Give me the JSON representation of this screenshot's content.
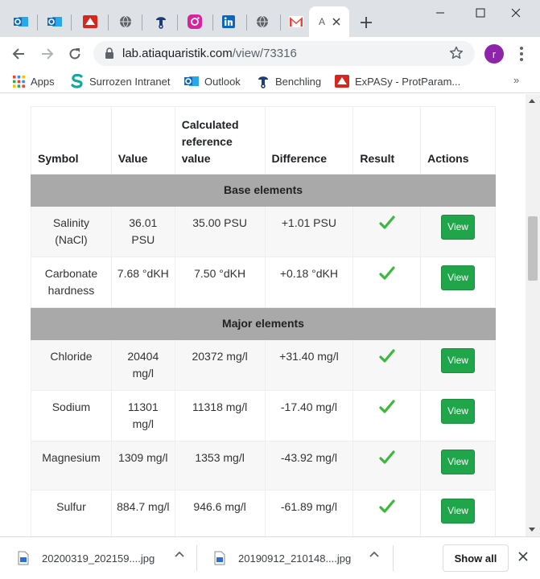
{
  "window": {
    "tabs": [
      {
        "icon": "outlook-icon",
        "color": "#0f6cbd"
      },
      {
        "icon": "outlook-icon",
        "color": "#0f6cbd"
      },
      {
        "icon": "expasy-icon",
        "color": "#d7261e"
      },
      {
        "icon": "globe-icon",
        "color": "#5f6368"
      },
      {
        "icon": "benchling-icon",
        "color": "#1f3b73"
      },
      {
        "icon": "instagram-icon",
        "color": "#d6249f"
      },
      {
        "icon": "linkedin-icon",
        "color": "#0a66c2"
      },
      {
        "icon": "globe-icon",
        "color": "#5f6368"
      },
      {
        "icon": "gmail-icon",
        "color": "#ea4335"
      }
    ],
    "active_tab_title": "A"
  },
  "toolbar": {
    "url_host": "lab.atiaquaristik.com",
    "url_path": "/view/73316",
    "profile_initial": "r"
  },
  "bookmarks": [
    {
      "label": "Apps",
      "icon": "apps-grid-icon"
    },
    {
      "label": "Surrozen Intranet",
      "icon": "surrozen-icon"
    },
    {
      "label": "Outlook",
      "icon": "outlook-icon"
    },
    {
      "label": "Benchling",
      "icon": "benchling-icon"
    },
    {
      "label": "ExPASy - ProtParam...",
      "icon": "expasy-icon"
    }
  ],
  "table": {
    "headers": {
      "symbol": "Symbol",
      "value": "Value",
      "reference": "Calculated reference value",
      "difference": "Difference",
      "result": "Result",
      "actions": "Actions"
    },
    "sections": [
      {
        "title": "Base elements",
        "rows": [
          {
            "symbol": "Salinity (NaCl)",
            "value": "36.01 PSU",
            "reference": "35.00 PSU",
            "difference": "+1.01 PSU",
            "action": "View"
          },
          {
            "symbol": "Carbonate hardness",
            "value": "7.68 °dKH",
            "reference": "7.50 °dKH",
            "difference": "+0.18 °dKH",
            "action": "View"
          }
        ]
      },
      {
        "title": "Major elements",
        "rows": [
          {
            "symbol": "Chloride",
            "value": "20404 mg/l",
            "reference": "20372 mg/l",
            "difference": "+31.40 mg/l",
            "action": "View"
          },
          {
            "symbol": "Sodium",
            "value": "11301 mg/l",
            "reference": "11318 mg/l",
            "difference": "-17.40 mg/l",
            "action": "View"
          },
          {
            "symbol": "Magnesium",
            "value": "1309 mg/l",
            "reference": "1353 mg/l",
            "difference": "-43.92 mg/l",
            "action": "View"
          },
          {
            "symbol": "Sulfur",
            "value": "884.7 mg/l",
            "reference": "946.6 mg/l",
            "difference": "-61.89 mg/l",
            "action": "View"
          }
        ]
      }
    ]
  },
  "downloads": {
    "items": [
      {
        "filename": "20200319_202159....jpg"
      },
      {
        "filename": "20190912_210148....jpg"
      }
    ],
    "show_all": "Show all"
  },
  "colors": {
    "view_button": "#21a54a",
    "section_header": "#a9a9a9",
    "check": "#3cb83c"
  }
}
